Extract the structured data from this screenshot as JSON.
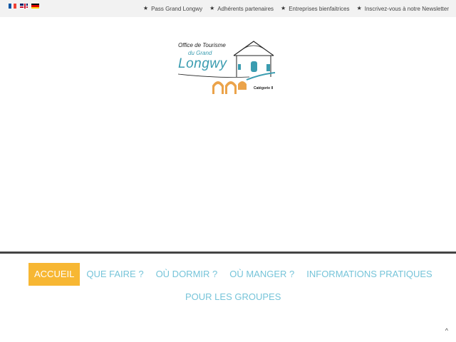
{
  "languages": [
    {
      "code": "fr",
      "colors": [
        "#0055A4",
        "#FFFFFF",
        "#EF4135"
      ]
    },
    {
      "code": "en",
      "colors": [
        "#012169",
        "#FFFFFF",
        "#C8102E"
      ]
    },
    {
      "code": "de",
      "colors": [
        "#000000",
        "#DD0000",
        "#FFCE00"
      ]
    }
  ],
  "toplinks": [
    {
      "label": "Pass Grand Longwy",
      "icon": "star-icon"
    },
    {
      "label": "Adhérents partenaires",
      "icon": "star-icon"
    },
    {
      "label": "Entreprises bienfaitrices",
      "icon": "star-icon"
    },
    {
      "label": "Inscrivez-vous à notre Newsletter",
      "icon": "star-icon"
    }
  ],
  "logo": {
    "line1": "Office de Tourisme",
    "line2": "du Grand",
    "line3": "Longwy",
    "category": "Catégorie II",
    "colors": {
      "teal": "#3a9cb0",
      "orange": "#e8932a",
      "dark": "#222222"
    }
  },
  "nav": {
    "items": [
      {
        "label": "ACCUEIL",
        "active": true
      },
      {
        "label": "QUE FAIRE ?"
      },
      {
        "label": "OÙ DORMIR ?"
      },
      {
        "label": "OÙ MANGER ?"
      },
      {
        "label": "INFORMATIONS PRATIQUES"
      }
    ],
    "second_row": [
      {
        "label": "POUR LES GROUPES"
      }
    ]
  },
  "colors": {
    "accent": "#f7b733",
    "nav_text": "#76c4d9",
    "topbar_bg": "#f2f2f2"
  },
  "scroll_top": {
    "icon": "chevron-up-icon",
    "glyph": "^"
  }
}
